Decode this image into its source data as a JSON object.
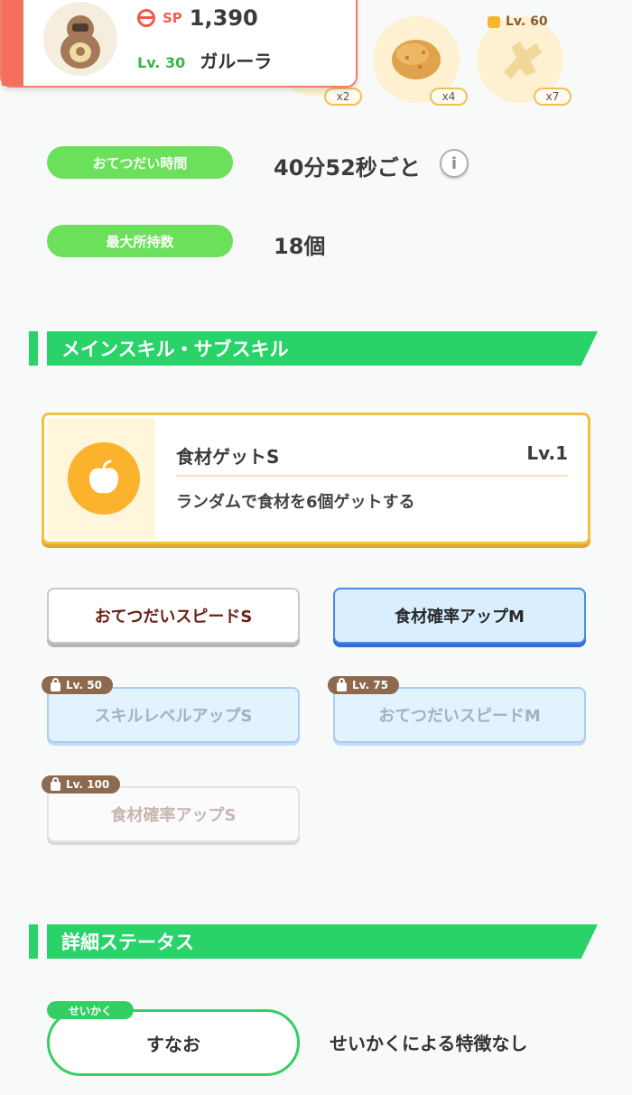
{
  "header": {
    "sp_label": "SP",
    "sp_value": "1,390",
    "level": "Lv. 30",
    "name": "ガルーラ",
    "ingredients": [
      {
        "icon": "partial-ingredient-icon",
        "count": "x2"
      },
      {
        "icon": "potato-icon",
        "count": "x4"
      },
      {
        "icon": "ginger-icon",
        "count": "x7",
        "lock_level": "Lv. 60"
      }
    ]
  },
  "help_time": {
    "label": "おてつだい時間",
    "value": "40分52秒ごと"
  },
  "max_carry": {
    "label": "最大所持数",
    "value": "18個"
  },
  "skills_section": {
    "title": "メインスキル・サブスキル",
    "main_skill": {
      "name": "食材ゲットS",
      "level": "Lv.1",
      "description": "ランダムで食材を6個ゲットする",
      "icon": "apple-icon",
      "icon_color": "#fbb22c"
    },
    "sub_skills": [
      {
        "label": "おてつだいスピードS",
        "state": "unlocked"
      },
      {
        "label": "食材確率アップM",
        "state": "unlocked-gold"
      },
      {
        "label": "スキルレベルアップS",
        "state": "locked",
        "lock_level": "Lv. 50"
      },
      {
        "label": "おてつだいスピードM",
        "state": "locked",
        "lock_level": "Lv. 75"
      },
      {
        "label": "食材確率アップS",
        "state": "locked",
        "lock_level": "Lv. 100"
      }
    ]
  },
  "status_section": {
    "title": "詳細ステータス",
    "nature_tag": "せいかく",
    "nature_value": "すなお",
    "nature_desc": "せいかくによる特徴なし"
  },
  "colors": {
    "accent_green": "#2ad26a",
    "pill_green": "#6be05a",
    "card_red": "#f5705c",
    "gold": "#f3c23d",
    "lock_brown": "#8c6a4f"
  }
}
